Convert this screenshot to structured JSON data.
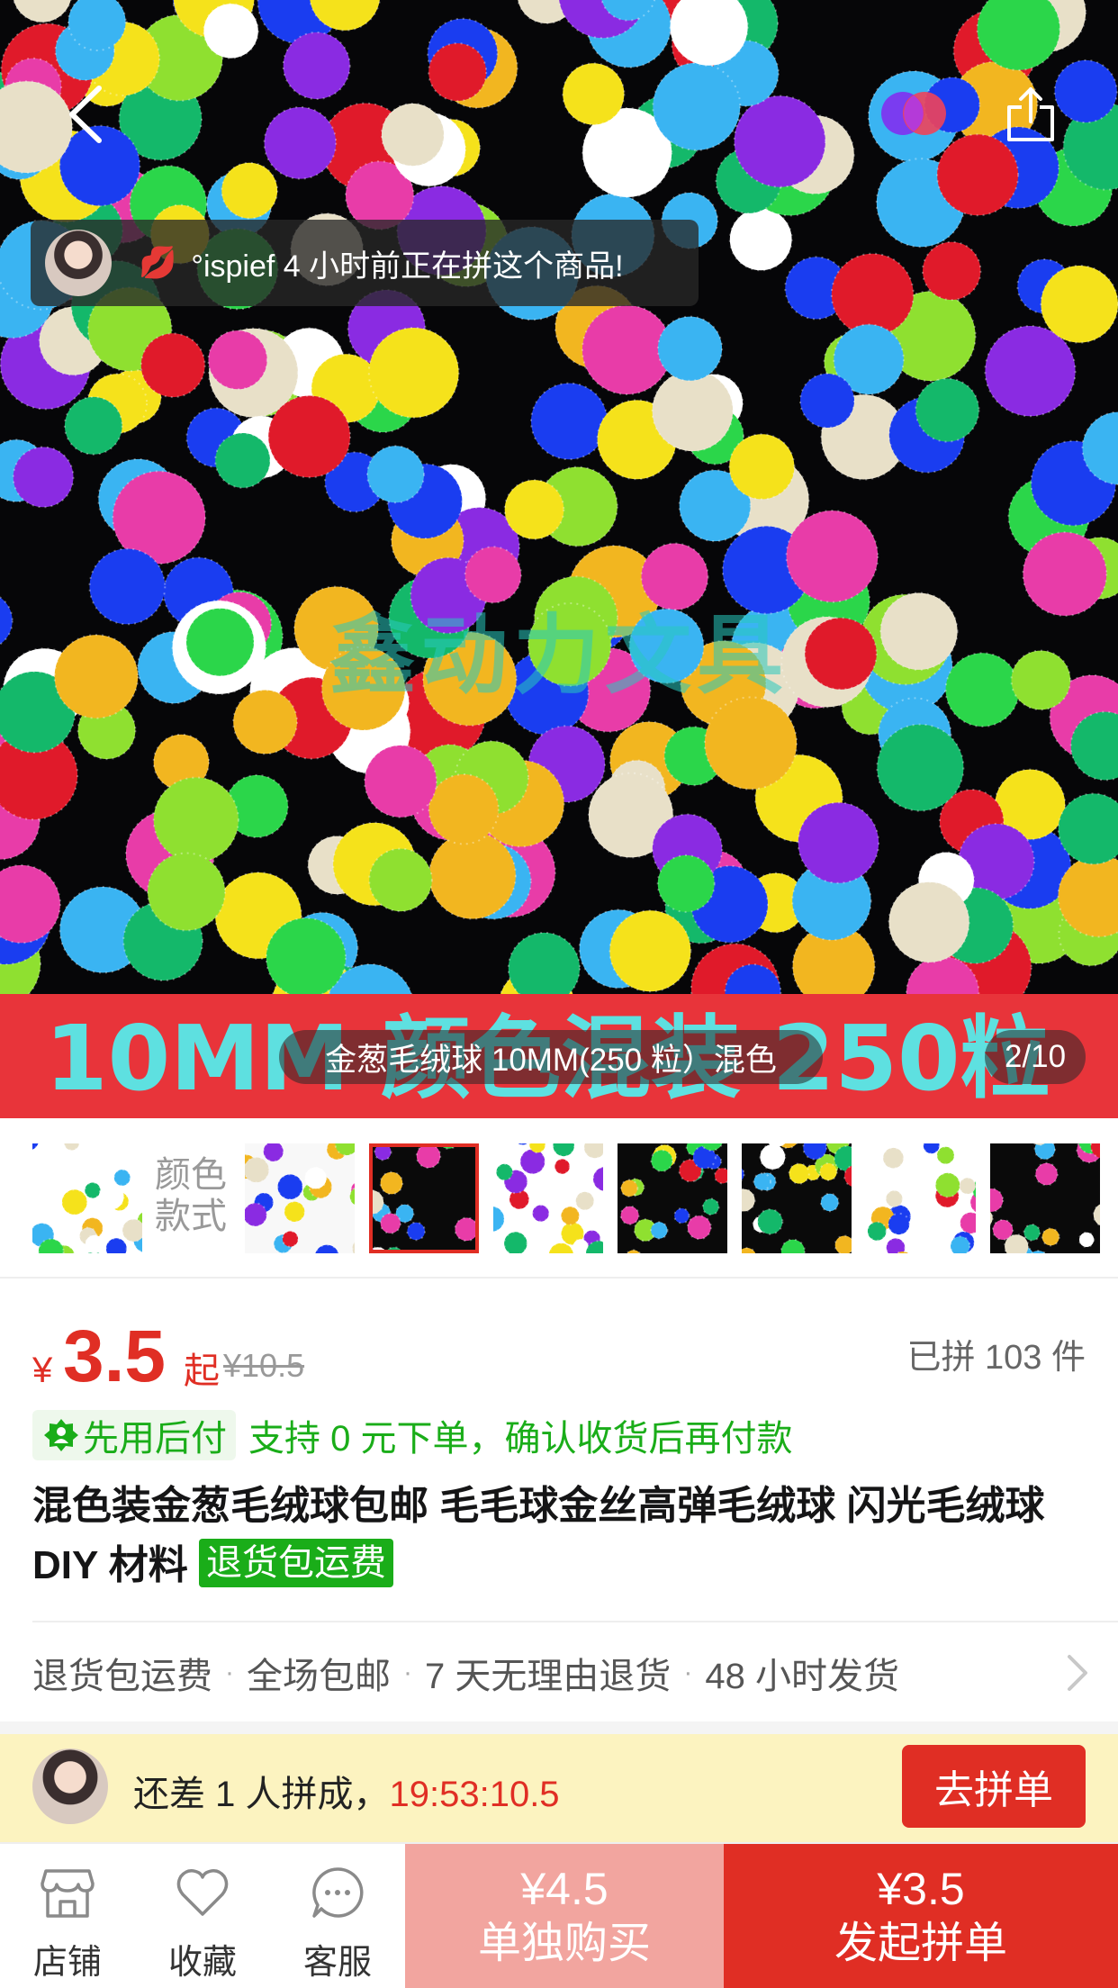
{
  "hero": {
    "watermark": "鑫动力文具",
    "banner_text": "10MM 颜色混装 250粒",
    "notice_text": "°ispief 4 小时前正在拼这个商品!",
    "caption": "金葱毛绒球 10MM(250 粒）混色",
    "page_indicator": "2/10"
  },
  "thumbs": {
    "type_label": "颜色款式",
    "count": 8,
    "selected_index": 2
  },
  "price": {
    "currency": "¥",
    "value": "3.5",
    "suffix": "起",
    "original": "¥10.5",
    "sold": "已拼 103 件"
  },
  "pay": {
    "label": "先用后付",
    "desc": "支持 0 元下单，确认收货后再付款"
  },
  "product": {
    "title": "混色装金葱毛绒球包邮 毛毛球金丝高弹毛绒球 闪光毛绒球 DIY 材料",
    "tag": "退货包运费"
  },
  "services": [
    "退货包运费",
    "全场包邮",
    "7 天无理由退货",
    "48 小时发货"
  ],
  "group": {
    "msg": "还差 1 人拼成，",
    "timer": "19:53:10.5",
    "join_label": "去拼单"
  },
  "bottom": {
    "store": "店铺",
    "favorite": "收藏",
    "service": "客服",
    "solo_price": "¥4.5",
    "solo_label": "单独购买",
    "group_price": "¥3.5",
    "group_label": "发起拼单"
  },
  "colors": {
    "accent_red": "#e02e24",
    "green": "#1aad19",
    "group_bar_bg": "#fcf3c0"
  }
}
